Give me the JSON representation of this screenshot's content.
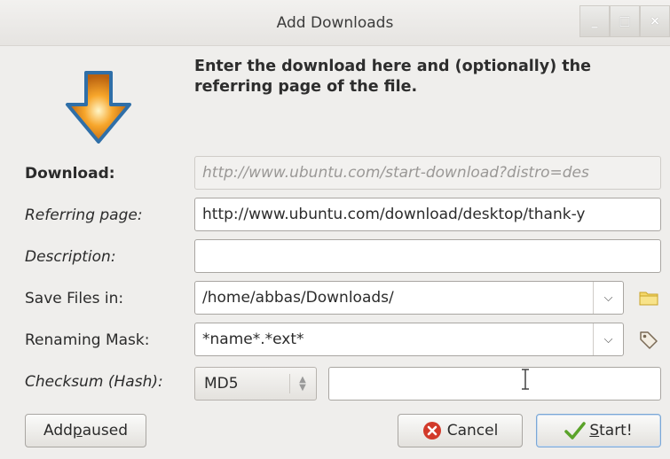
{
  "window": {
    "title": "Add Downloads",
    "controls": {
      "minimize": "_",
      "maximize": "□",
      "close": "×"
    }
  },
  "header": {
    "icon": "download-arrow-icon",
    "text": "Enter the download here and (optionally) the referring page of the file."
  },
  "form": {
    "download": {
      "label": "Download:",
      "value": "http://www.ubuntu.com/start-download?distro=des"
    },
    "referrer": {
      "label": "Referring page:",
      "value": "http://www.ubuntu.com/download/desktop/thank-y"
    },
    "description": {
      "label": "Description:",
      "value": ""
    },
    "save_in": {
      "label": "Save Files in:",
      "value": "/home/abbas/Downloads/",
      "icon": "folder-icon"
    },
    "renaming_mask": {
      "label": "Renaming Mask:",
      "value": "*name*.*ext*",
      "icon": "tag-icon"
    },
    "checksum": {
      "label": "Checksum (Hash):",
      "algorithm": "MD5",
      "value": ""
    }
  },
  "buttons": {
    "add_paused": {
      "pre": "Add ",
      "mnemonic": "p",
      "post": "aused"
    },
    "cancel": "Cancel",
    "start": {
      "mnemonic": "S",
      "post": "tart!"
    }
  },
  "colors": {
    "arrow_orange": "#f7a62b",
    "arrow_blue": "#2f6fa8",
    "cancel_red": "#d23a2a",
    "start_green": "#5aa32a"
  }
}
